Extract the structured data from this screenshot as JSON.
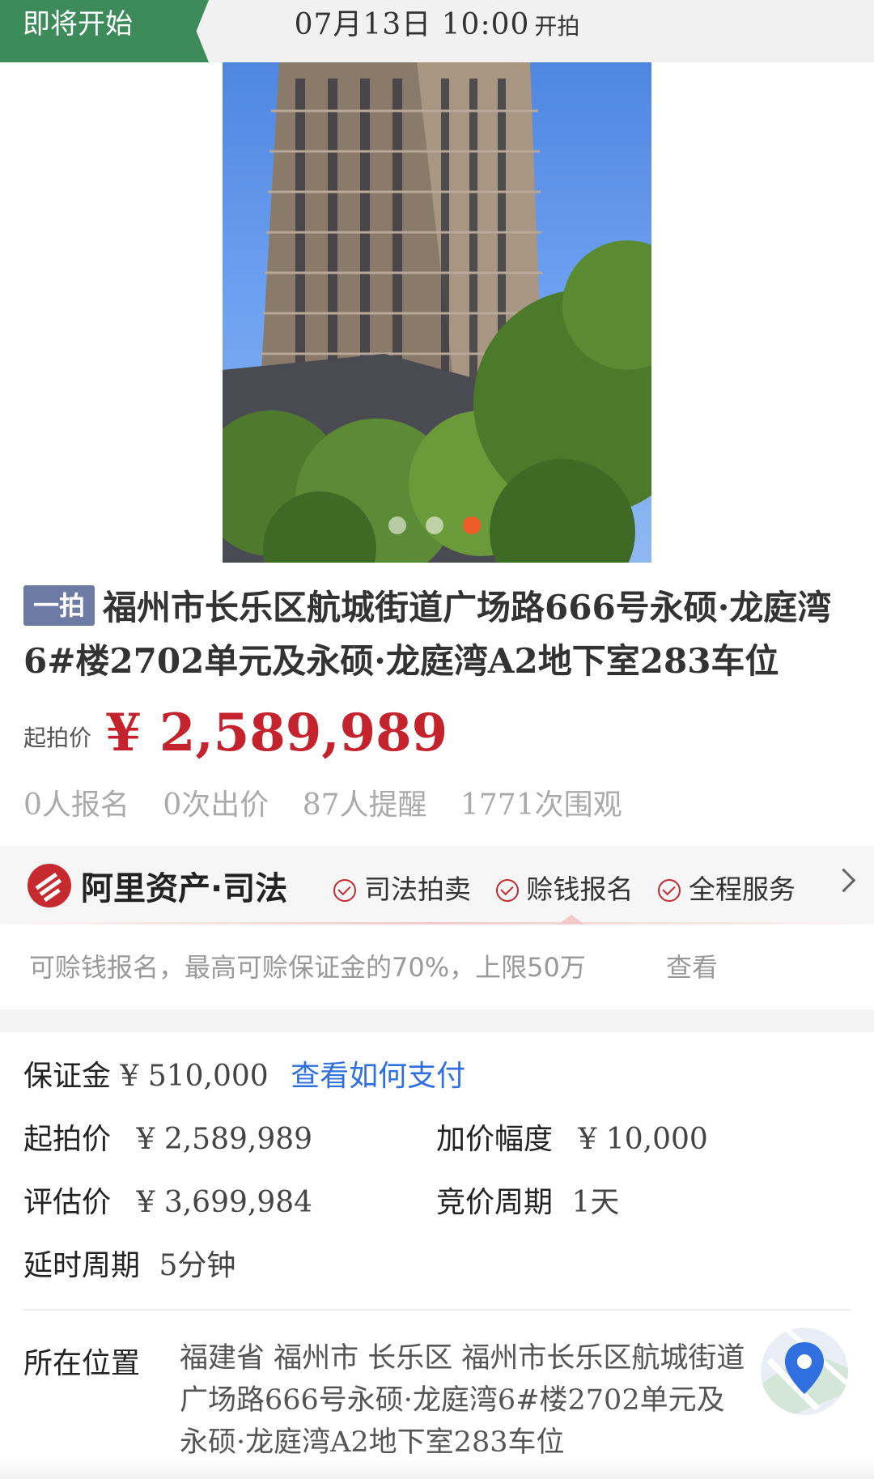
{
  "hero": {
    "status": "即将开始",
    "start_time": "07月13日 10:00",
    "start_suffix": "开拍",
    "carousel_count": 3,
    "carousel_active": 3
  },
  "lot": {
    "round_badge": "一拍",
    "title": "福州市长乐区航城街道广场路666号永硕·龙庭湾6#楼2702单元及永硕·龙庭湾A2地下室283车位",
    "price_label": "起拍价",
    "price": "¥ 2,589,989",
    "stats": [
      "0人报名",
      "0次出价",
      "87人提醒",
      "1771次围观"
    ]
  },
  "ali": {
    "brand": "阿里资产·司法",
    "features": [
      "司法拍卖",
      "赊钱报名",
      "全程服务"
    ],
    "note": "可赊钱报名，最高可赊保证金的70%，上限50万",
    "note_link": "查看"
  },
  "details": {
    "deposit_label": "保证金",
    "deposit_value": "¥ 510,000",
    "deposit_link": "查看如何支付",
    "start_price_label": "起拍价",
    "start_price_value": "¥ 2,589,989",
    "increment_label": "加价幅度",
    "increment_value": "¥ 10,000",
    "appraisal_label": "评估价",
    "appraisal_value": "¥ 3,699,984",
    "cycle_label": "竞价周期",
    "cycle_value": "1天",
    "delay_label": "延时周期",
    "delay_value": "5分钟",
    "location_label": "所在位置",
    "location_value": "福建省 福州市 长乐区 福州市长乐区航城街道广场路666号永硕·龙庭湾6#楼2702单元及永硕·龙庭湾A2地下室283车位"
  },
  "colors": {
    "status_green": "#3d8a5a",
    "price_red": "#c4232d",
    "link_blue": "#2f6fe0",
    "ali_red": "#c62a2f",
    "badge_blue": "#6d7aa3",
    "dot_active": "#f05a28"
  },
  "icons": [
    "check-icon",
    "chevron-right-icon",
    "ali-logo-icon",
    "map-pin-icon"
  ]
}
